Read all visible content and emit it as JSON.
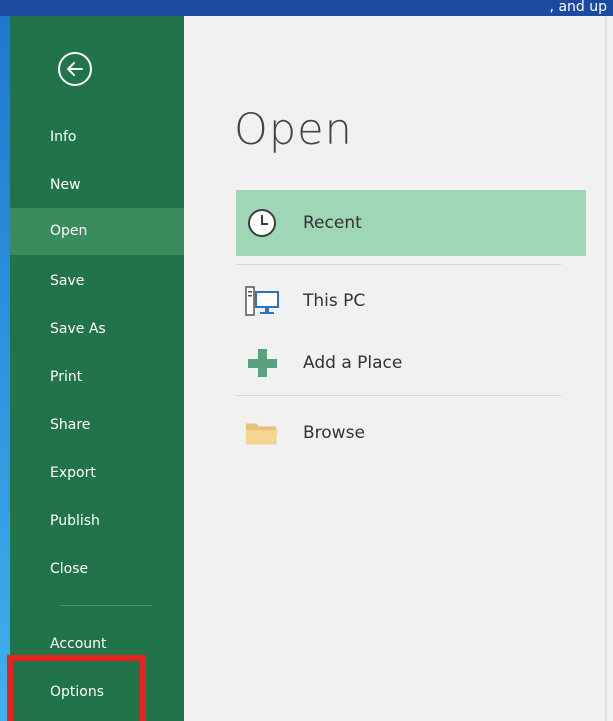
{
  "title_strip": {
    "text": ", and up"
  },
  "backstage": {
    "back_label": "Back",
    "nav": [
      {
        "id": "info",
        "label": "Info"
      },
      {
        "id": "new",
        "label": "New"
      },
      {
        "id": "open",
        "label": "Open",
        "active": true
      },
      {
        "id": "save",
        "label": "Save"
      },
      {
        "id": "save-as",
        "label": "Save As"
      },
      {
        "id": "print",
        "label": "Print"
      },
      {
        "id": "share",
        "label": "Share"
      },
      {
        "id": "export",
        "label": "Export"
      },
      {
        "id": "publish",
        "label": "Publish"
      },
      {
        "id": "close",
        "label": "Close"
      },
      {
        "id": "account",
        "label": "Account"
      },
      {
        "id": "options",
        "label": "Options"
      }
    ]
  },
  "main": {
    "title": "Open",
    "places": [
      {
        "id": "recent",
        "label": "Recent",
        "icon": "clock-icon",
        "active": true
      },
      {
        "id": "this-pc",
        "label": "This PC",
        "icon": "computer-icon"
      },
      {
        "id": "add-place",
        "label": "Add a Place",
        "icon": "plus-icon"
      },
      {
        "id": "browse",
        "label": "Browse",
        "icon": "folder-icon"
      }
    ]
  },
  "colors": {
    "sidebar_bg": "#21734a",
    "sidebar_active": "#3a8c5e",
    "recent_highlight": "#9fd6b5",
    "annotation_red": "#e8221c"
  }
}
